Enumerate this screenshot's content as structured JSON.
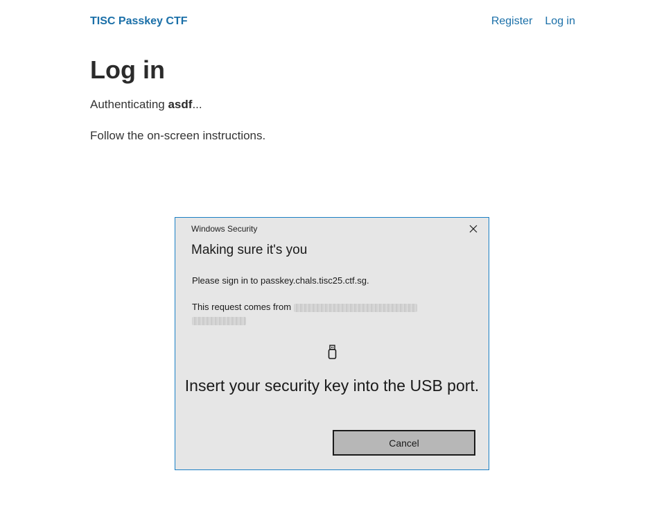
{
  "header": {
    "brand": "TISC Passkey CTF",
    "nav": {
      "register": "Register",
      "login": "Log in"
    }
  },
  "main": {
    "title": "Log in",
    "auth_prefix": "Authenticating ",
    "username": "asdf",
    "auth_suffix": "...",
    "instructions": "Follow the on-screen instructions."
  },
  "dialog": {
    "window_title": "Windows Security",
    "heading": "Making sure it's you",
    "signin_text": "Please sign in to passkey.chals.tisc25.ctf.sg.",
    "request_text": "This request comes from ",
    "icon": "usb-security-key-icon",
    "insert_text": "Insert your security key into the USB port.",
    "cancel_label": "Cancel",
    "close_icon": "close-icon",
    "accent_color": "#1a7fc4",
    "background_color": "#e6e6e6"
  },
  "colors": {
    "link": "#1a6fa8",
    "text": "#333333"
  }
}
